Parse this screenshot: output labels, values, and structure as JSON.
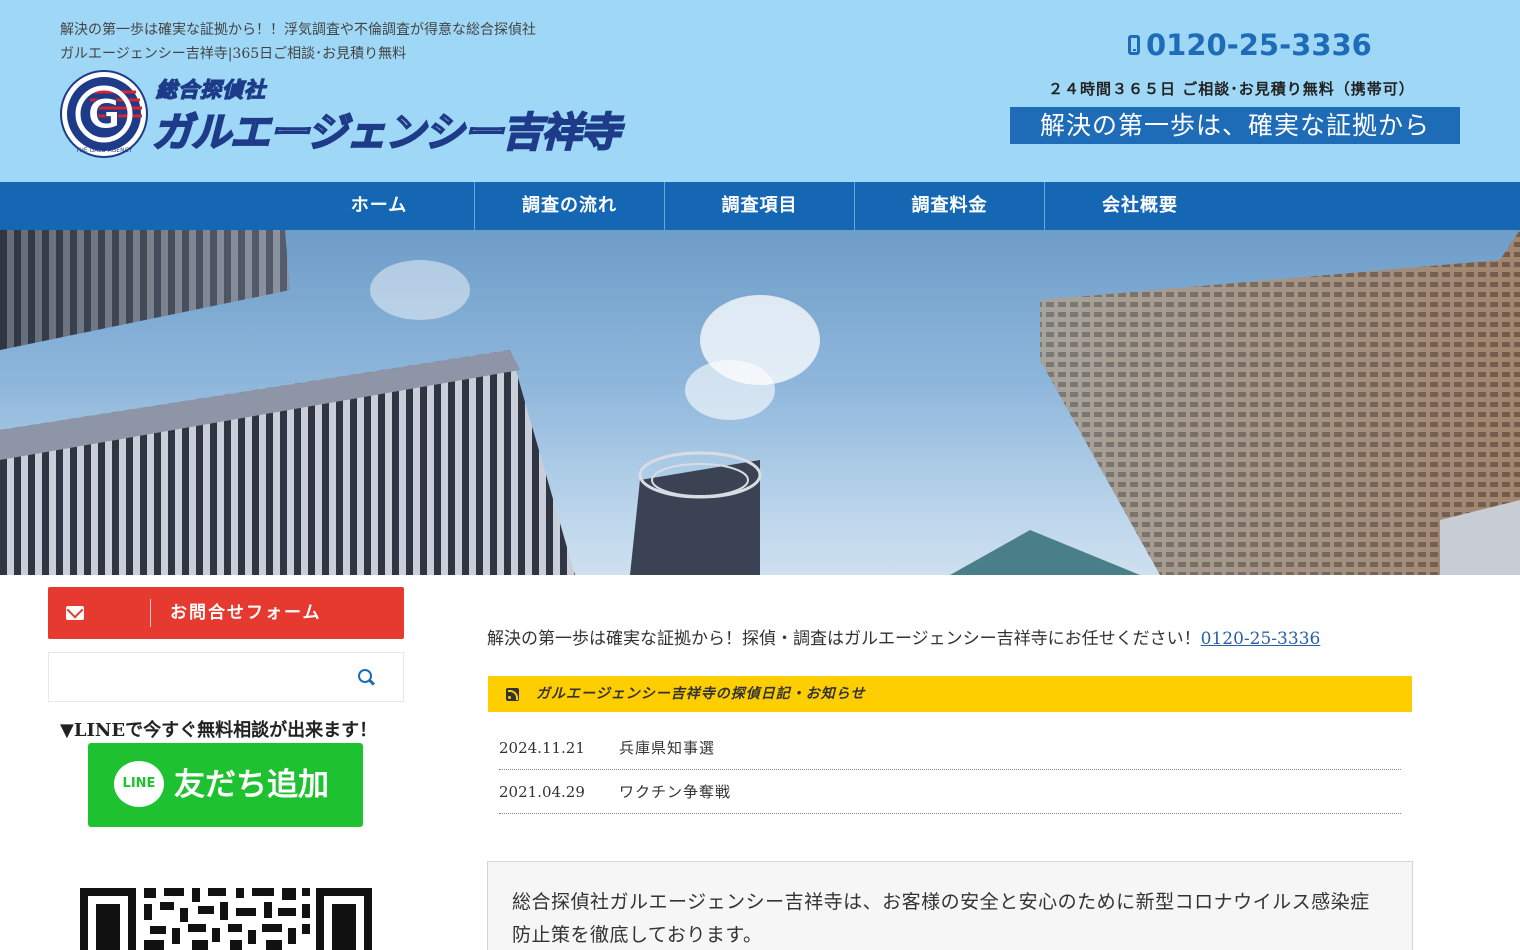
{
  "header": {
    "tagline_line1": "解決の第一歩は確実な証拠から！！浮気調査や不倫調査が得意な総合探偵社",
    "tagline_line2": "ガルエージェンシー吉祥寺|365日ご相談･お見積り無料",
    "logo_small": "総合探偵社",
    "logo_large": "ガルエージェンシー吉祥寺",
    "logo_emblem_text": "THE GALU AGENCY",
    "phone": "0120-25-3336",
    "hours": "２４時間３６５日 ご相談･お見積り無料（携帯可）",
    "slogan": "解決の第一歩は、確実な証拠から"
  },
  "nav": {
    "items": [
      {
        "label": "ホーム"
      },
      {
        "label": "調査の流れ"
      },
      {
        "label": "調査項目"
      },
      {
        "label": "調査料金"
      },
      {
        "label": "会社概要"
      }
    ]
  },
  "sidebar": {
    "contact_label": "お問合せフォーム",
    "search_placeholder": "",
    "line_note": "▼LINEで今すぐ無料相談が出来ます！",
    "line_logo_text": "LINE",
    "line_button_label": "友だち追加"
  },
  "main": {
    "intro_text": "解決の第一歩は確実な証拠から！探偵・調査はガルエージェンシー吉祥寺にお任せください！",
    "intro_phone": "0120-25-3336",
    "news_header": "ガルエージェンシー吉祥寺の探偵日記・お知らせ",
    "news": [
      {
        "date": "2024.11.21",
        "title": "兵庫県知事選"
      },
      {
        "date": "2021.04.29",
        "title": "ワクチン争奪戦"
      }
    ],
    "notice_text": "総合探偵社ガルエージェンシー吉祥寺は、お客様の安全と安心のために新型コロナウイルス感染症防止策を徹底しております。"
  },
  "colors": {
    "header_bg": "#9fd8f6",
    "nav_bg": "#1567b4",
    "accent_blue": "#1e6bb8",
    "contact_red": "#e6392f",
    "news_yellow": "#fece00",
    "line_green": "#1ec230"
  }
}
